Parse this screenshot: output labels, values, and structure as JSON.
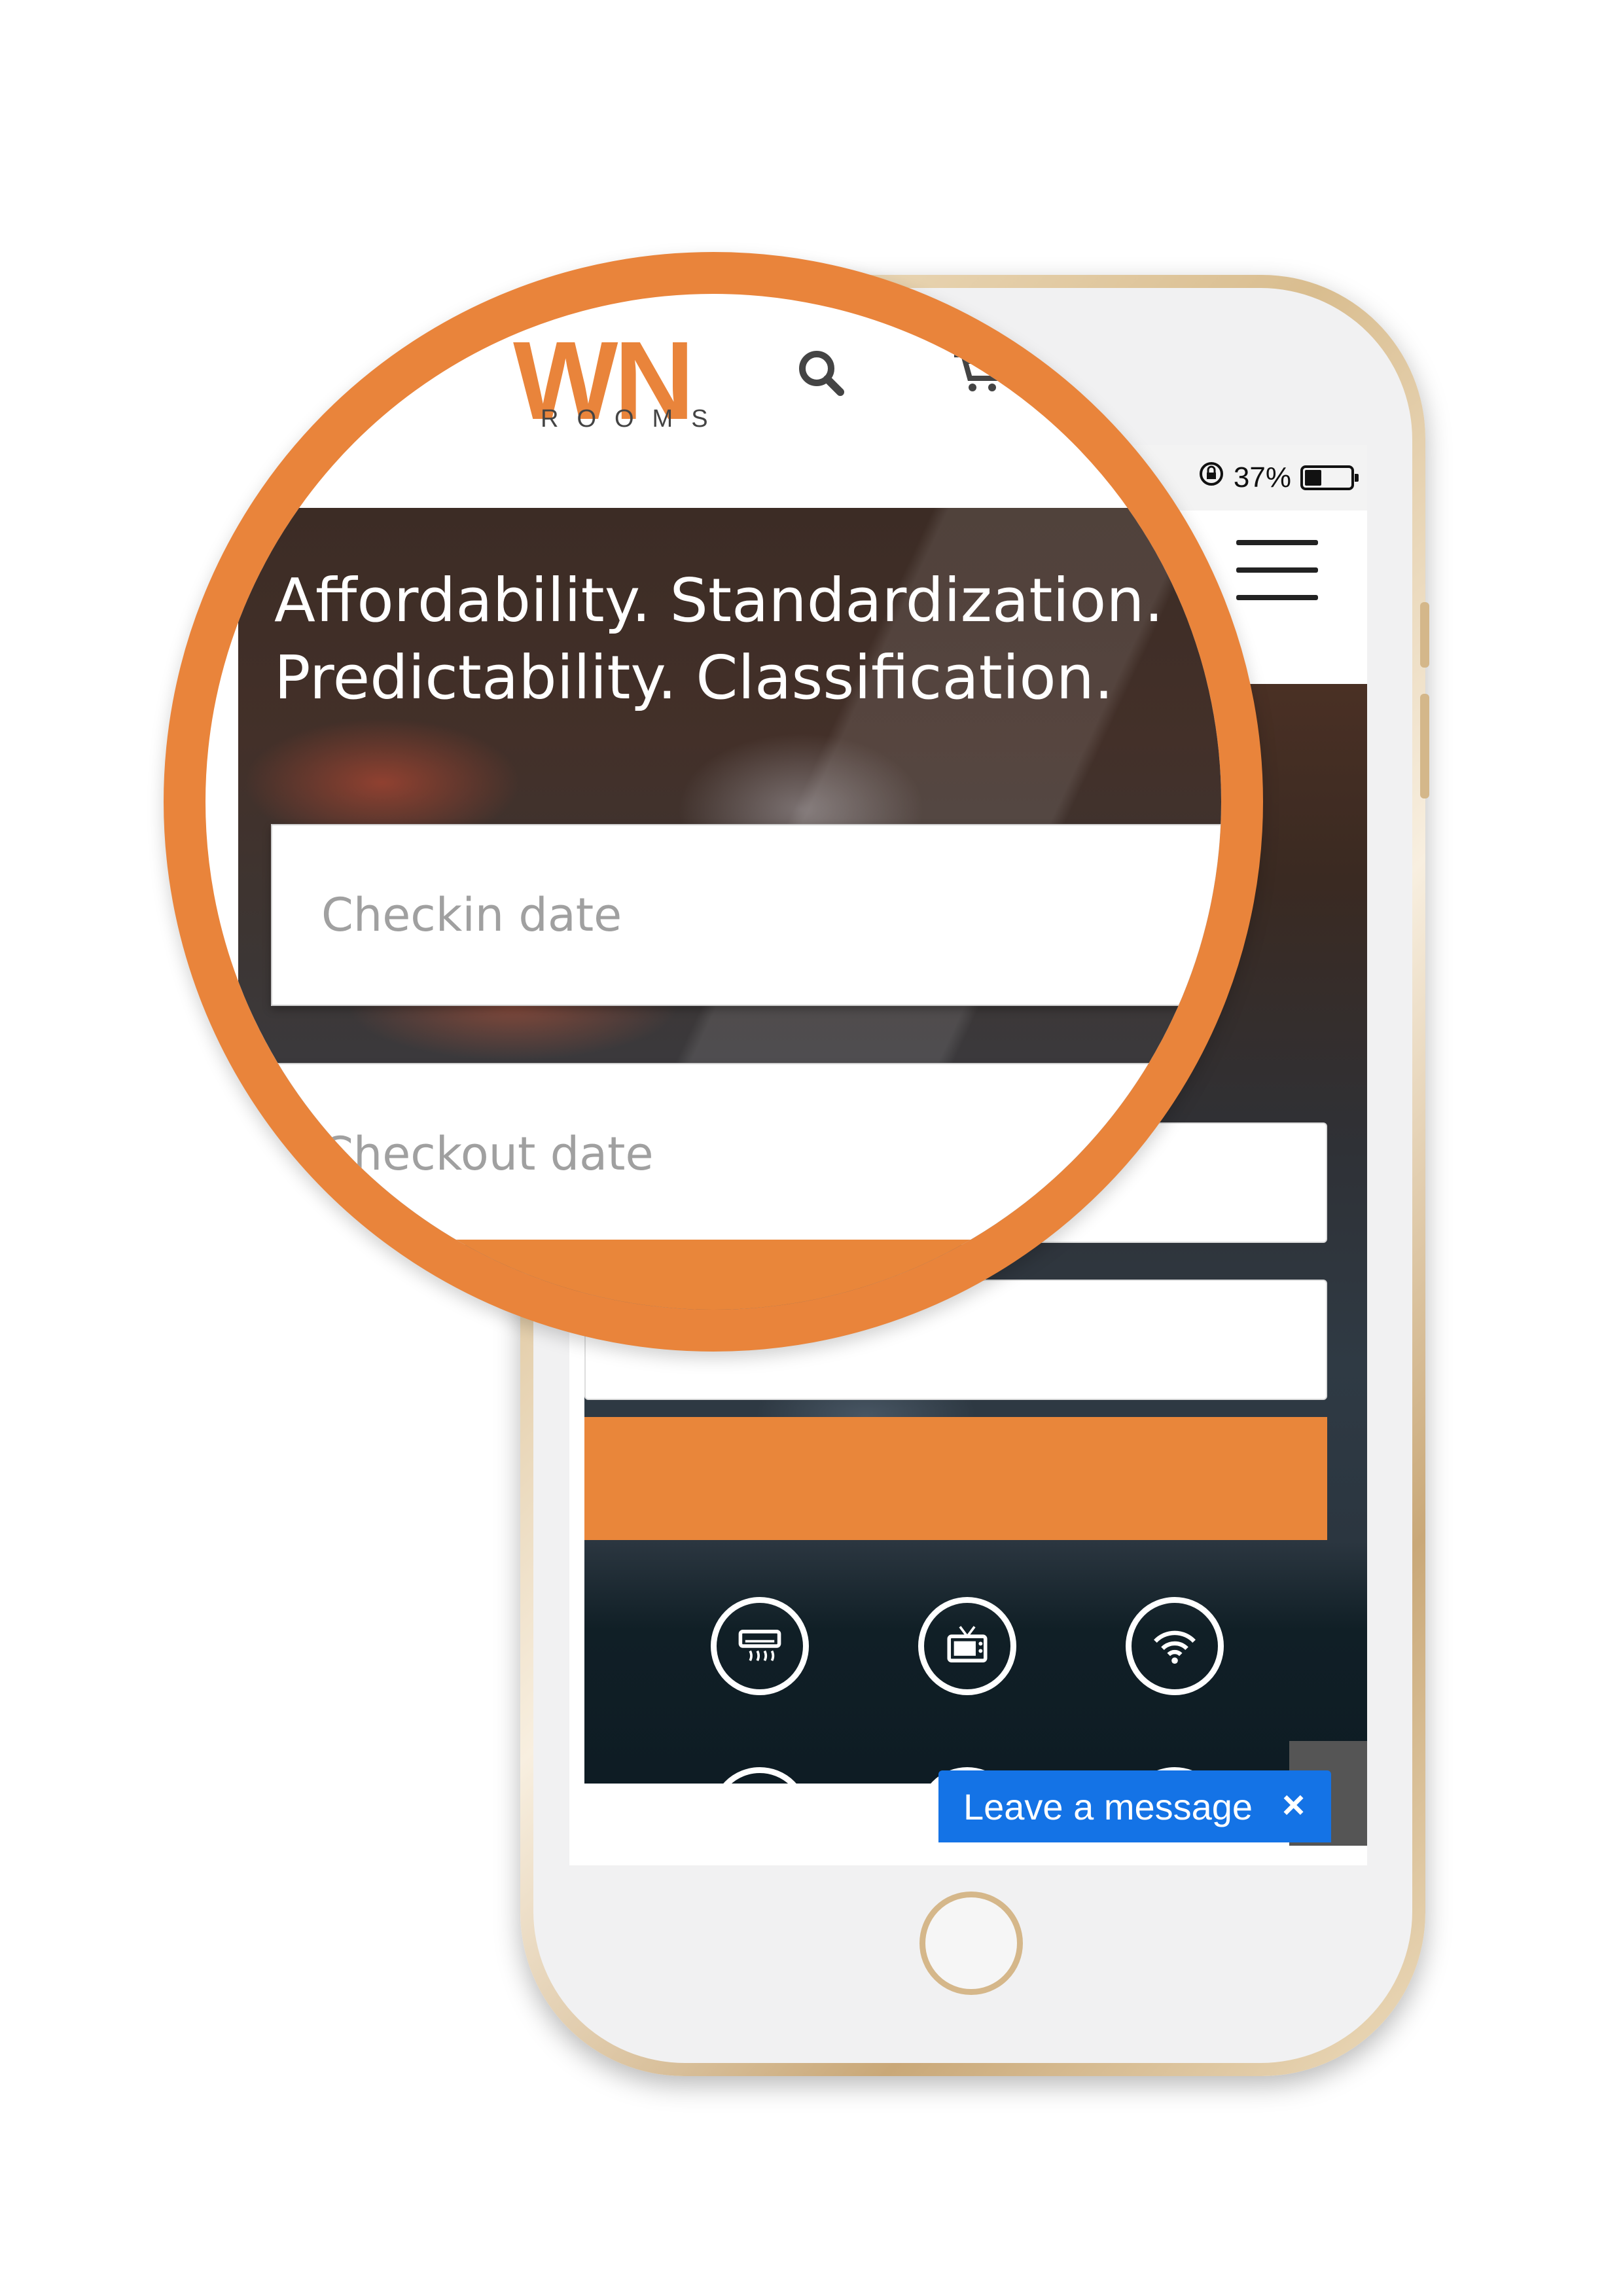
{
  "status_bar": {
    "battery_text": "37%",
    "battery_level": 0.37
  },
  "header": {
    "logo_text": "WN",
    "logo_sub": "ROOMS"
  },
  "hero": {
    "tagline_line1": "Affordability. Standardization.",
    "tagline_line2": "Predictability. Classification.",
    "checkin_placeholder": "Checkin date",
    "checkout_placeholder": "Checkout date"
  },
  "amenities": [
    {
      "icon": "air-conditioner-icon"
    },
    {
      "icon": "tv-icon"
    },
    {
      "icon": "wifi-icon"
    },
    {
      "icon": "coffee-icon"
    },
    {
      "icon": "bed-icon"
    },
    {
      "icon": "toilet-paper-icon"
    }
  ],
  "chat_widget": {
    "label": "Leave a message",
    "close_glyph": "×"
  },
  "colors": {
    "accent": "#e9843b",
    "chat": "#1473e6"
  }
}
